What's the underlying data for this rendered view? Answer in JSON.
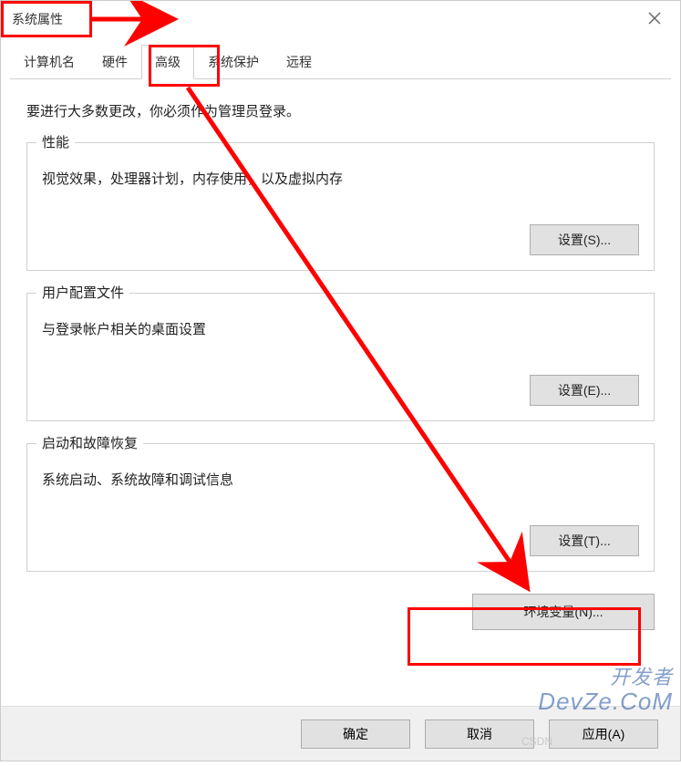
{
  "window": {
    "title": "系统属性"
  },
  "tabs": {
    "t0": "计算机名",
    "t1": "硬件",
    "t2": "高级",
    "t3": "系统保护",
    "t4": "远程"
  },
  "intro": "要进行大多数更改，你必须作为管理员登录。",
  "groups": {
    "perf": {
      "title": "性能",
      "desc": "视觉效果，处理器计划，内存使用，以及虚拟内存",
      "btn": "设置(S)..."
    },
    "profile": {
      "title": "用户配置文件",
      "desc": "与登录帐户相关的桌面设置",
      "btn": "设置(E)..."
    },
    "startup": {
      "title": "启动和故障恢复",
      "desc": "系统启动、系统故障和调试信息",
      "btn": "设置(T)..."
    }
  },
  "env_btn": "环境变量(N)...",
  "bottom": {
    "ok": "确定",
    "cancel": "取消",
    "apply": "应用(A)"
  },
  "watermark": {
    "l1": "开发者",
    "l2": "DevZe.CoM",
    "wm2": "CSDN"
  }
}
